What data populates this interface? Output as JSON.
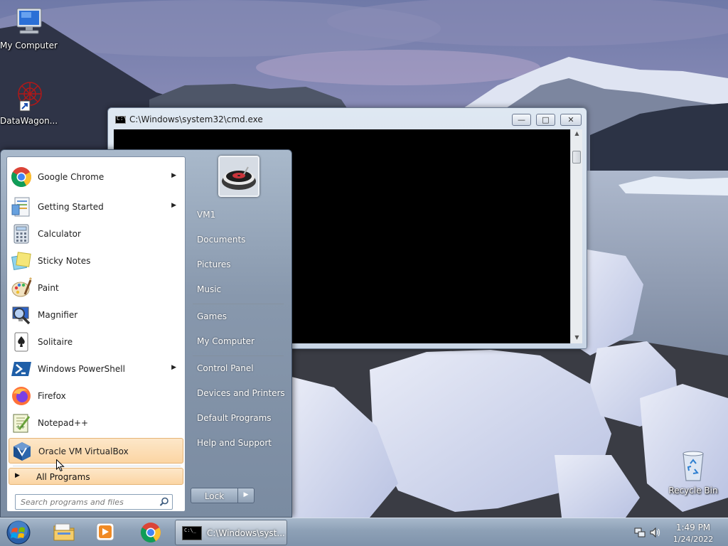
{
  "desktop": {
    "icons": [
      {
        "label": "My Computer",
        "icon": "computer-icon"
      },
      {
        "label": "DataWagon...",
        "icon": "datawagon-shortcut-icon"
      },
      {
        "label": "Recycle Bin",
        "icon": "recycle-bin-icon"
      }
    ]
  },
  "cmd_window": {
    "title": "C:\\Windows\\system32\\cmd.exe",
    "icon": "cmd-icon"
  },
  "start_menu": {
    "programs": [
      {
        "label": "Google Chrome",
        "icon": "chrome-icon",
        "has_submenu": true
      },
      {
        "label": "Getting Started",
        "icon": "getting-started-icon",
        "has_submenu": true
      },
      {
        "label": "Calculator",
        "icon": "calculator-icon",
        "has_submenu": false
      },
      {
        "label": "Sticky Notes",
        "icon": "sticky-notes-icon",
        "has_submenu": false
      },
      {
        "label": "Paint",
        "icon": "paint-icon",
        "has_submenu": false
      },
      {
        "label": "Magnifier",
        "icon": "magnifier-icon",
        "has_submenu": false
      },
      {
        "label": "Solitaire",
        "icon": "solitaire-icon",
        "has_submenu": false
      },
      {
        "label": "Windows PowerShell",
        "icon": "powershell-icon",
        "has_submenu": true
      },
      {
        "label": "Firefox",
        "icon": "firefox-icon",
        "has_submenu": false
      },
      {
        "label": "Notepad++",
        "icon": "notepadpp-icon",
        "has_submenu": false
      },
      {
        "label": "Oracle VM VirtualBox",
        "icon": "virtualbox-icon",
        "has_submenu": false,
        "highlighted": true
      }
    ],
    "all_programs_label": "All Programs",
    "search_placeholder": "Search programs and files",
    "places": [
      {
        "label": "VM1"
      },
      {
        "label": "Documents"
      },
      {
        "label": "Pictures"
      },
      {
        "label": "Music"
      },
      {
        "label": "Games"
      },
      {
        "label": "My Computer"
      },
      {
        "label": "Control Panel"
      },
      {
        "label": "Devices and Printers"
      },
      {
        "label": "Default Programs"
      },
      {
        "label": "Help and Support"
      }
    ],
    "lock_label": "Lock"
  },
  "taskbar": {
    "pinned": [
      {
        "icon": "file-explorer-icon"
      },
      {
        "icon": "media-player-icon"
      },
      {
        "icon": "chrome-icon"
      }
    ],
    "task_label": "C:\\Windows\\syst...",
    "clock_time": "1:49 PM",
    "clock_date": "1/24/2022"
  },
  "colors": {
    "highlight": "#fbd5a3",
    "taskbar": "#8da0b6"
  }
}
